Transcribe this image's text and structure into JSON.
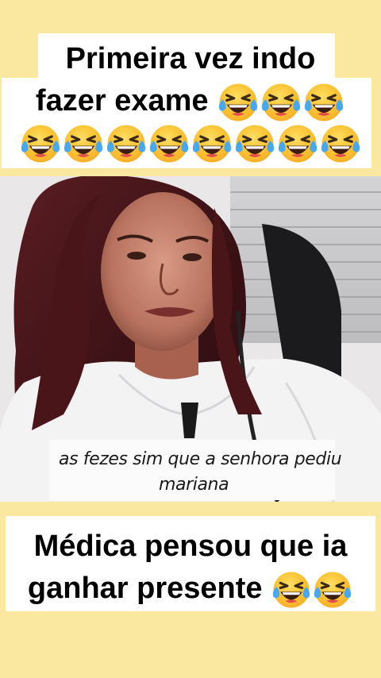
{
  "colors": {
    "background": "#fbe8a0",
    "caption_bg": "#ffffff",
    "caption_text": "#111111"
  },
  "top_caption": {
    "line1": "Primeira vez indo",
    "line2": "fazer exame",
    "emoji": "laughing-tears-emoji"
  },
  "video": {
    "subtitle_line1": "as fezes sim que a senhora pediu",
    "subtitle_line2": "mariana"
  },
  "bottom_caption": {
    "line1": "Médica pensou que ia",
    "line2": "ganhar presente",
    "emoji": "laughing-tears-emoji"
  }
}
